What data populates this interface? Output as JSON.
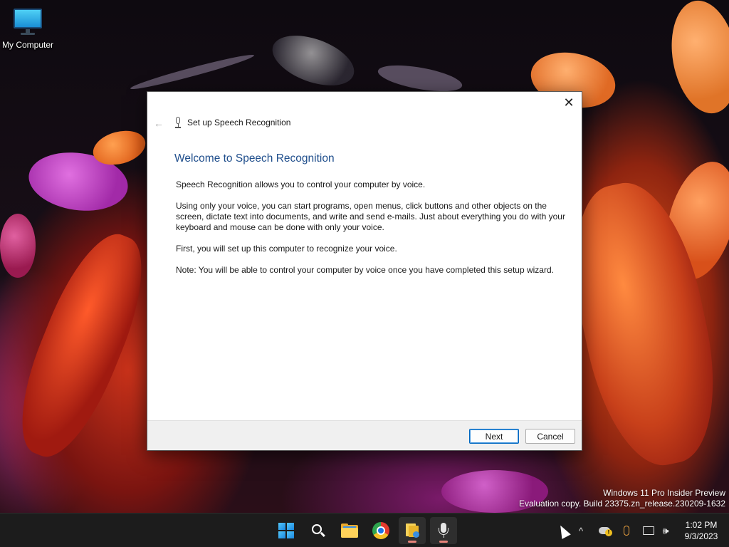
{
  "desktop": {
    "icons": [
      {
        "label": "My Computer",
        "icon": "monitor-icon"
      }
    ],
    "watermark": {
      "line1": "Windows 11 Pro Insider Preview",
      "line2": "Evaluation copy. Build 23375.zn_release.230209-1632"
    }
  },
  "dialog": {
    "window_title": "Set up Speech Recognition",
    "close_glyph": "✕",
    "back_glyph": "←",
    "heading": "Welcome to Speech Recognition",
    "paragraphs": [
      "Speech Recognition allows you to control your computer by voice.",
      "Using only your voice, you can start programs, open menus, click buttons and other objects on the screen, dictate text into documents, and write and send e-mails. Just about everything you do with your keyboard and mouse can be done with only your voice.",
      "First, you will set up this computer to recognize your voice.",
      "Note: You will be able to control your computer by voice once you have completed this setup wizard."
    ],
    "buttons": {
      "next": "Next",
      "cancel": "Cancel"
    },
    "colors": {
      "heading": "#1f4e8c",
      "primary_border": "#0067c0"
    }
  },
  "taskbar": {
    "apps": [
      {
        "name": "start",
        "icon": "windows-logo-icon"
      },
      {
        "name": "search",
        "icon": "search-icon"
      },
      {
        "name": "file-explorer",
        "icon": "folder-icon"
      },
      {
        "name": "chrome",
        "icon": "chrome-icon"
      },
      {
        "name": "contacts",
        "icon": "notes-icon",
        "running": true
      },
      {
        "name": "speech-recognition",
        "icon": "microphone-icon",
        "active": true
      }
    ],
    "tray": {
      "chevron_glyph": "^",
      "volume_glyph": "🕪",
      "warning_glyph": "!",
      "time": "1:02 PM",
      "date": "9/3/2023"
    },
    "indicator_color": "#e8837a"
  }
}
